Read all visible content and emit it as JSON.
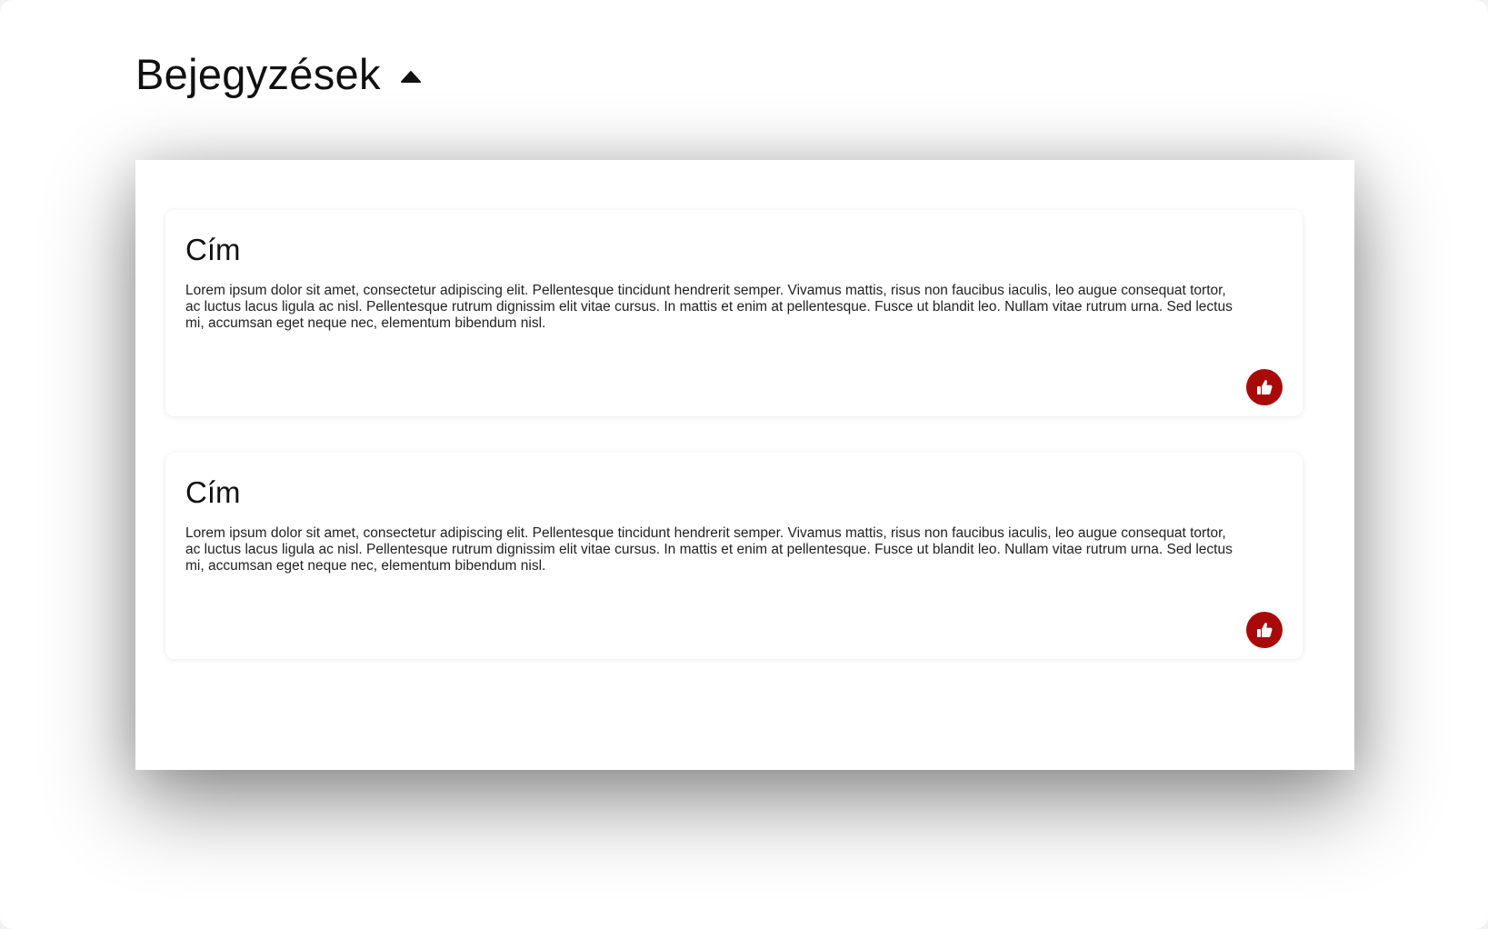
{
  "header": {
    "title": "Bejegyzések",
    "toggle_icon": "caret-up-icon"
  },
  "theme": {
    "accent": "#a80a0a",
    "background": "#ffffff"
  },
  "posts": [
    {
      "title": "Cím",
      "body": "Lorem ipsum dolor sit amet, consectetur adipiscing elit. Pellentesque tincidunt hendrerit semper. Vivamus mattis, risus non faucibus iaculis, leo augue consequat tortor, ac luctus lacus ligula ac nisl. Pellentesque rutrum dignissim elit vitae cursus. In mattis et enim at pellentesque. Fusce ut blandit leo. Nullam vitae rutrum urna. Sed lectus mi, accumsan eget neque nec, elementum bibendum nisl.",
      "like_icon": "thumbs-up-icon"
    },
    {
      "title": "Cím",
      "body": "Lorem ipsum dolor sit amet, consectetur adipiscing elit. Pellentesque tincidunt hendrerit semper. Vivamus mattis, risus non faucibus iaculis, leo augue consequat tortor, ac luctus lacus ligula ac nisl. Pellentesque rutrum dignissim elit vitae cursus. In mattis et enim at pellentesque. Fusce ut blandit leo. Nullam vitae rutrum urna. Sed lectus mi, accumsan eget neque nec, elementum bibendum nisl.",
      "like_icon": "thumbs-up-icon"
    }
  ]
}
